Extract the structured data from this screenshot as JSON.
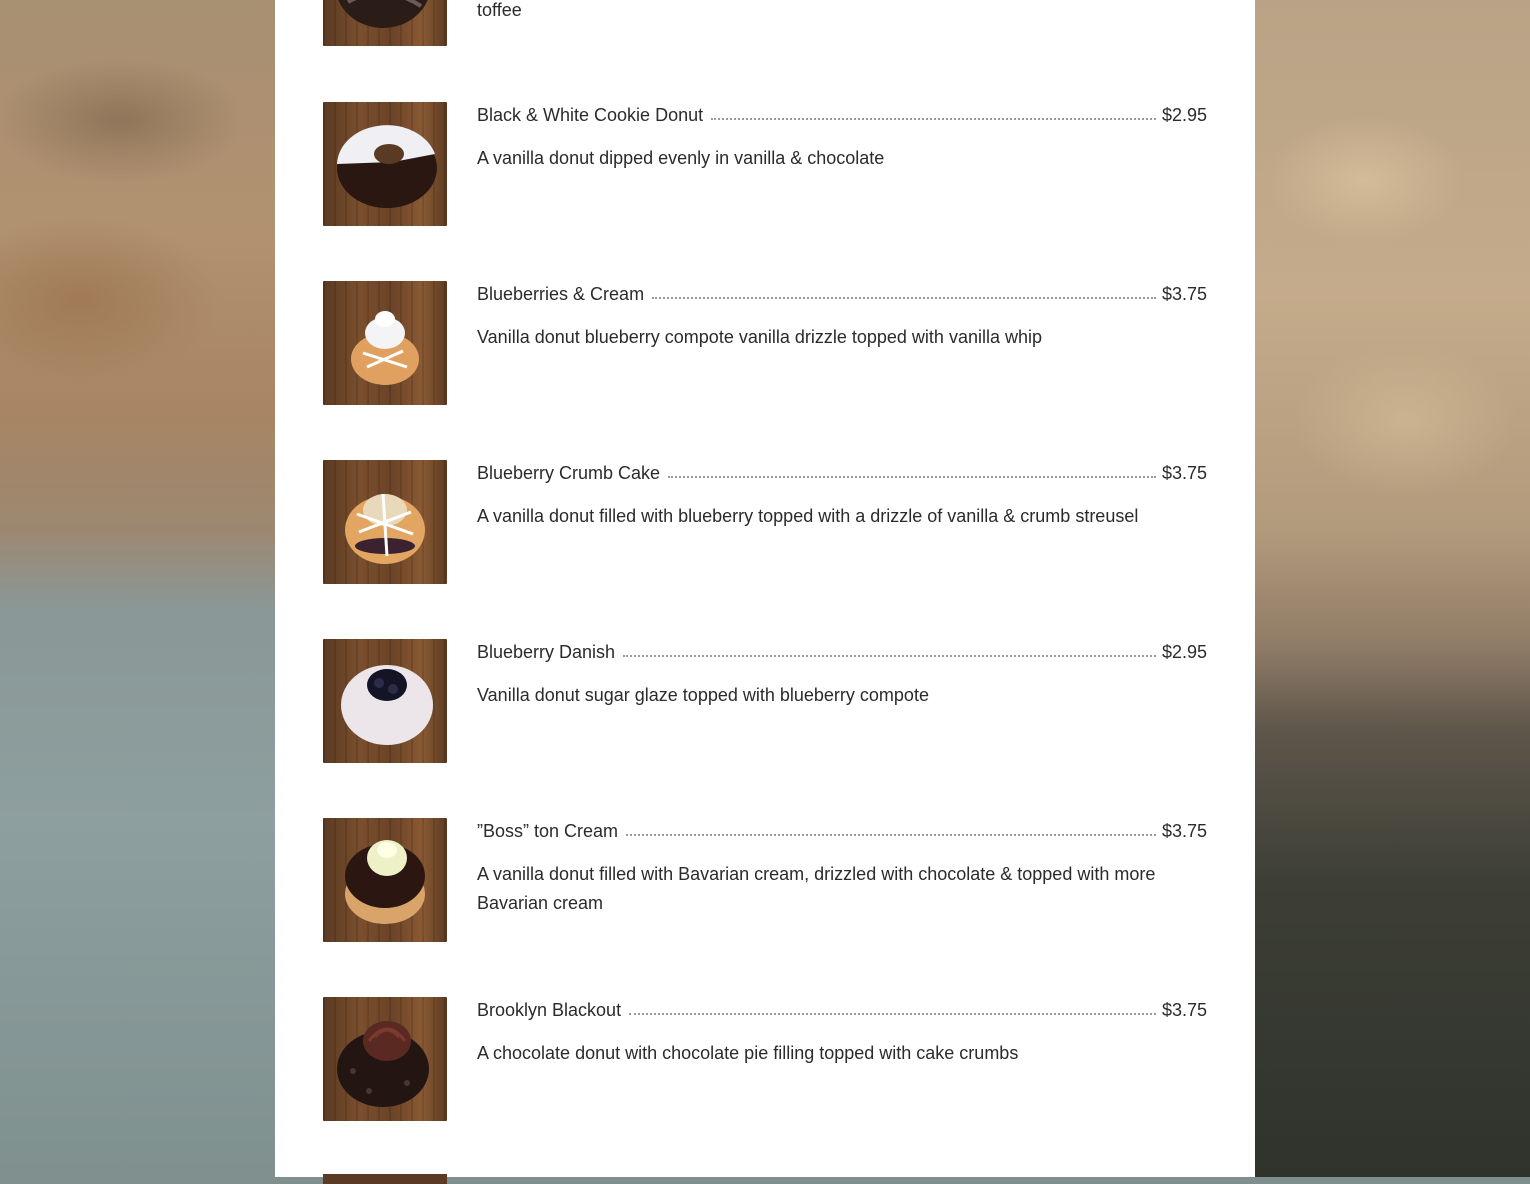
{
  "menu": {
    "partial_top_desc": "toffee",
    "items": [
      {
        "name": "Black & White Cookie Donut",
        "price": "$2.95",
        "desc": "A vanilla donut dipped evenly in vanilla & chocolate"
      },
      {
        "name": "Blueberries & Cream",
        "price": "$3.75",
        "desc": "Vanilla donut blueberry compote vanilla drizzle topped with vanilla whip"
      },
      {
        "name": "Blueberry Crumb Cake",
        "price": "$3.75",
        "desc": "A vanilla donut filled with blueberry topped with a drizzle of vanilla & crumb streusel"
      },
      {
        "name": "Blueberry Danish",
        "price": "$2.95",
        "desc": "Vanilla donut sugar glaze topped with blueberry compote"
      },
      {
        "name": "”Boss” ton Cream",
        "price": "$3.75",
        "desc": "A vanilla donut filled with Bavarian cream, drizzled with chocolate & topped with more Bavarian cream"
      },
      {
        "name": "Brooklyn Blackout",
        "price": "$3.75",
        "desc": "A chocolate donut with chocolate pie filling topped with cake crumbs"
      }
    ]
  }
}
